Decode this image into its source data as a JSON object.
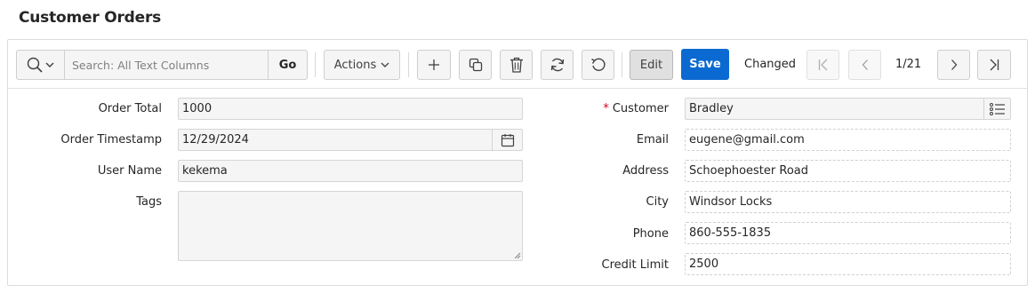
{
  "page": {
    "title": "Customer Orders"
  },
  "toolbar": {
    "search_placeholder": "Search: All Text Columns",
    "go_label": "Go",
    "actions_label": "Actions",
    "edit_label": "Edit",
    "save_label": "Save",
    "status_text": "Changed",
    "record_counter": "1/21",
    "icons": [
      "search-icon",
      "chevron-down-icon",
      "plus-icon",
      "copy-icon",
      "trash-icon",
      "refresh-icon",
      "undo-icon",
      "first-record-icon",
      "previous-record-icon",
      "next-record-icon",
      "last-record-icon"
    ]
  },
  "form": {
    "left": {
      "order_total": {
        "label": "Order Total",
        "value": "1000"
      },
      "order_timestamp": {
        "label": "Order Timestamp",
        "value": "12/29/2024"
      },
      "user_name": {
        "label": "User Name",
        "value": "kekema"
      },
      "tags": {
        "label": "Tags",
        "value": ""
      }
    },
    "right": {
      "customer": {
        "label": "Customer",
        "required_marker": "*",
        "value": "Bradley"
      },
      "email": {
        "label": "Email",
        "value": "eugene@gmail.com"
      },
      "address": {
        "label": "Address",
        "value": "Schoephoester Road"
      },
      "city": {
        "label": "City",
        "value": "Windsor Locks"
      },
      "phone": {
        "label": "Phone",
        "value": "860-555-1835"
      },
      "credit_limit": {
        "label": "Credit Limit",
        "value": "2500"
      }
    }
  },
  "colors": {
    "primary": "#0b6ad1",
    "required": "#d0021b"
  }
}
